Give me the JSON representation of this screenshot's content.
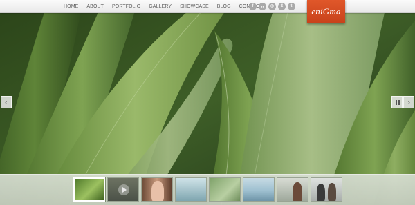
{
  "nav": {
    "items": [
      "HOME",
      "ABOUT",
      "PORTFOLIO",
      "GALLERY",
      "SHOWCASE",
      "BLOG",
      "CONTACT"
    ]
  },
  "social": {
    "icons": [
      {
        "name": "facebook-icon",
        "glyph": "f"
      },
      {
        "name": "flickr-icon",
        "glyph": "●●"
      },
      {
        "name": "dribbble-icon",
        "glyph": "◎"
      },
      {
        "name": "skype-icon",
        "glyph": "S"
      },
      {
        "name": "twitter-icon",
        "glyph": "t"
      }
    ]
  },
  "logo": {
    "text": "eniGma"
  },
  "controls": {
    "prev": "‹",
    "next": "›"
  },
  "thumbnails": [
    {
      "name": "thumb-leaves",
      "active": true
    },
    {
      "name": "thumb-video",
      "active": false
    },
    {
      "name": "thumb-woman-portrait",
      "active": false
    },
    {
      "name": "thumb-waterfall",
      "active": false
    },
    {
      "name": "thumb-green-blur",
      "active": false
    },
    {
      "name": "thumb-sea",
      "active": false
    },
    {
      "name": "thumb-woman-beach",
      "active": false
    },
    {
      "name": "thumb-couple",
      "active": false
    }
  ],
  "colors": {
    "accent": "#d64b20",
    "nav_text": "#5c5c5c"
  }
}
